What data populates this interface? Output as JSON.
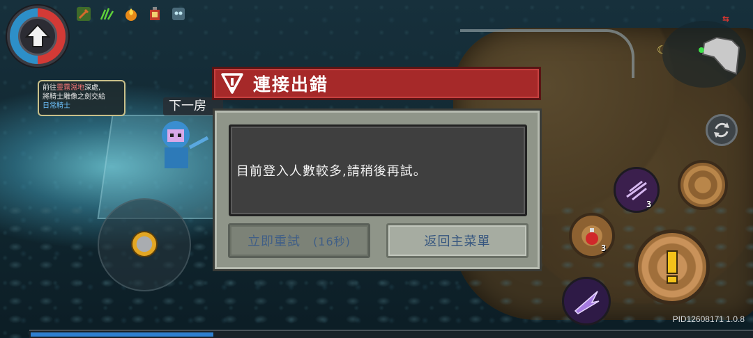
{
  "quest": {
    "prefix": "前往",
    "location": "靈霧濕地",
    "suffix_line1": "深處,",
    "line2": "將騎士雕像之劍交給",
    "npc": "日常騎士"
  },
  "next_room_label": "下一房",
  "dialog": {
    "title": "連接出錯",
    "message": "目前登入人數較多,請稍後再試。",
    "retry_label": "立即重試",
    "retry_countdown": "(16秒)",
    "menu_label": "返回主菜單"
  },
  "skills": {
    "dash_count": "3",
    "potion_count": "3"
  },
  "minimap": {
    "arrows": "⇆"
  },
  "version_text": "PID12608171 1.0.8",
  "colors": {
    "title_red": "#a62929",
    "dialog_gray": "#8f9589",
    "button_text_blue": "#36567f",
    "health_red": "#d33a36",
    "mana_blue": "#2d8fc8"
  },
  "icons": [
    "up-arrow-icon",
    "wrench-icon",
    "grass-icon",
    "flame-icon",
    "lantern-icon",
    "mask-icon",
    "warning-icon",
    "swap-icon",
    "dash-icon",
    "potion-icon",
    "exclamation-icon",
    "slash-icon"
  ]
}
